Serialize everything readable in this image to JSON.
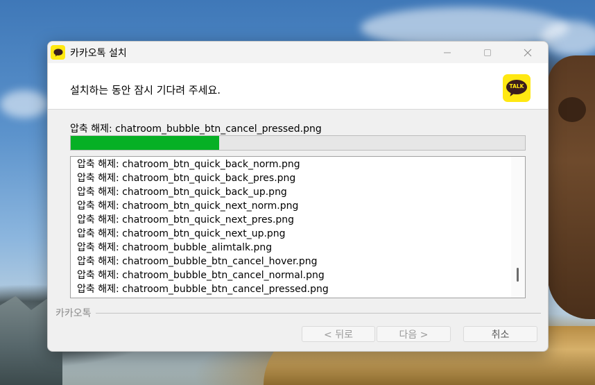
{
  "window": {
    "title": "카카오톡 설치",
    "header_text": "설치하는 동안 잠시 기다려 주세요.",
    "logo_text": "TALK"
  },
  "progress": {
    "current_file_text": "압축 해제: chatroom_bubble_btn_cancel_pressed.png",
    "fraction": 0.326,
    "color": "#06b025"
  },
  "log": {
    "items": [
      "압축 해제: chatroom_btn_quick_back_norm.png",
      "압축 해제: chatroom_btn_quick_back_pres.png",
      "압축 해제: chatroom_btn_quick_back_up.png",
      "압축 해제: chatroom_btn_quick_next_norm.png",
      "압축 해제: chatroom_btn_quick_next_pres.png",
      "압축 해제: chatroom_btn_quick_next_up.png",
      "압축 해제: chatroom_bubble_alimtalk.png",
      "압축 해제: chatroom_bubble_btn_cancel_hover.png",
      "압축 해제: chatroom_bubble_btn_cancel_normal.png",
      "압축 해제: chatroom_bubble_btn_cancel_pressed.png"
    ]
  },
  "footer": {
    "brand_label": "카카오톡",
    "back_label": "< 뒤로",
    "next_label": "다음 >",
    "cancel_label": "취소"
  },
  "colors": {
    "brand_yellow": "#ffe812"
  },
  "icons": {
    "app": "kakaotalk-icon",
    "minimize": "minimize-icon",
    "maximize": "maximize-icon",
    "close": "close-icon"
  }
}
